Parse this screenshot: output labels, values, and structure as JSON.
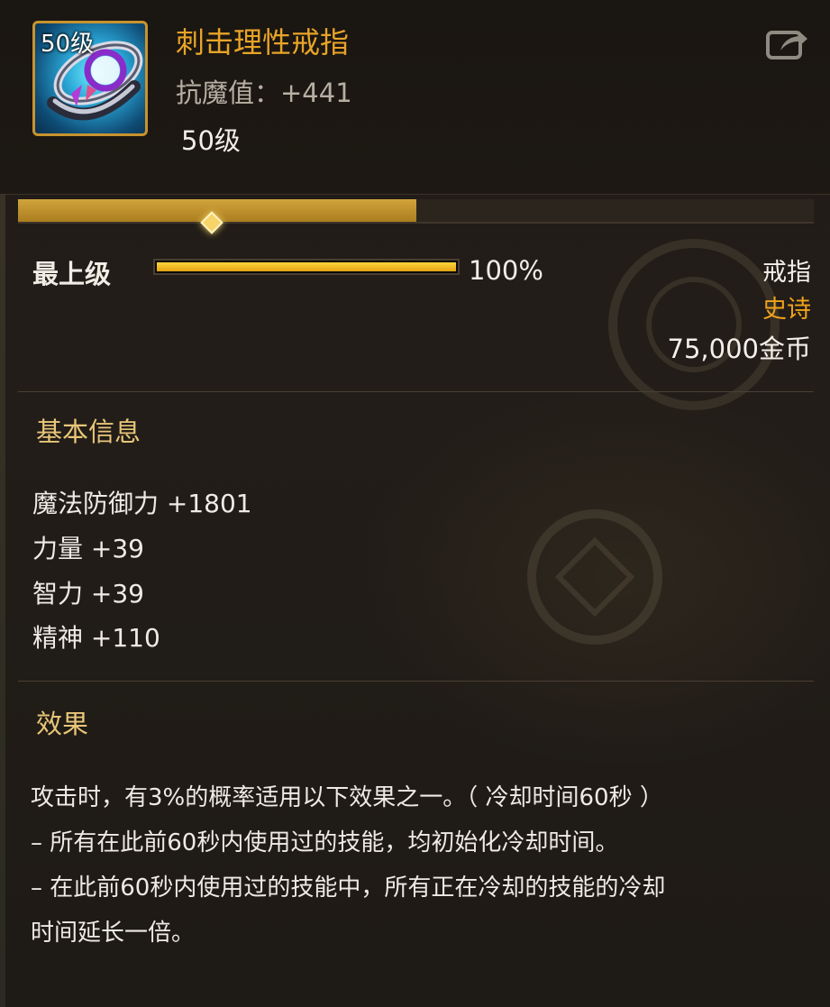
{
  "item": {
    "icon_level": "50级",
    "name": "刺击理性戒指",
    "resist": "抗魔值：+441",
    "level": "50级"
  },
  "grade": {
    "label": "最上级",
    "percent_text": "100%",
    "fill_fraction": 1.0
  },
  "reinforce_progress_fraction": 0.5,
  "meta": {
    "type": "戒指",
    "rarity": "史诗",
    "price": "75,000金币"
  },
  "basic": {
    "title": "基本信息",
    "stats": [
      "魔法防御力 +1801",
      "力量 +39",
      "智力 +39",
      "精神 +110"
    ]
  },
  "effect": {
    "title": "效果",
    "lines": [
      "攻击时，有3%的概率适用以下效果之一。（ 冷却时间60秒 ）",
      "– 所有在此前60秒内使用过的技能，均初始化冷却时间。",
      "– 在此前60秒内使用过的技能中，所有正在冷却的技能的冷却",
      "时间延长一倍。"
    ]
  },
  "colors": {
    "name": "#e8a428",
    "rarity_epic": "#f0a21b",
    "section_title": "#e9c679"
  },
  "icons": {
    "share": "share-icon",
    "item": "ring-icon"
  }
}
